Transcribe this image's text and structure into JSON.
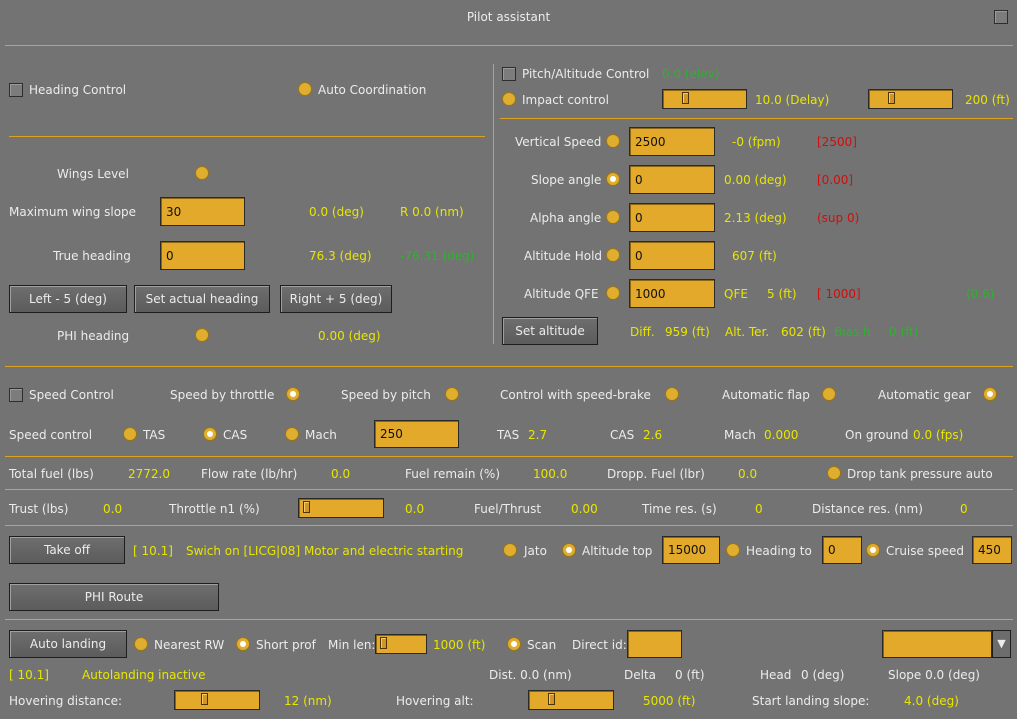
{
  "window": {
    "title": "Pilot assistant"
  },
  "heading": {
    "control_label": "Heading Control",
    "auto_coord_label": "Auto Coordination",
    "wings_level_label": "Wings Level",
    "max_wing_slope_label": "Maximum wing slope",
    "max_wing_slope_value": "30",
    "wing_slope_readout": "0.0 (deg)",
    "radius_readout": "R 0.0 (nm)",
    "true_heading_label": "True heading",
    "true_heading_value": "0",
    "true_heading_readout": "76.3 (deg)",
    "true_heading_delta": "-76.31 (deg)",
    "left_button": "Left - 5 (deg)",
    "set_actual_button": "Set actual heading",
    "right_button": "Right + 5 (deg)",
    "phi_heading_label": "PHI heading",
    "phi_heading_readout": "0.00 (deg)"
  },
  "pitch": {
    "control_label": "Pitch/Altitude Control",
    "elev_readout": "0.0 (elev)",
    "impact_label": "Impact control",
    "delay_readout": "10.0 (Delay)",
    "ft_readout": "200 (ft)",
    "delay_slider": 0.2,
    "ft_slider": 0.2,
    "rows": [
      {
        "label": "Vertical Speed",
        "value": "2500",
        "readout": "-0 (fpm)",
        "extra": "[2500]",
        "selected": false
      },
      {
        "label": "Slope angle",
        "value": "0",
        "readout": "0.00 (deg)",
        "extra": "[0.00]",
        "selected": true
      },
      {
        "label": "Alpha angle",
        "value": "0",
        "readout": "2.13 (deg)",
        "extra": "(sup 0)",
        "selected": false
      },
      {
        "label": "Altitude Hold",
        "value": "0",
        "readout": "607 (ft)",
        "extra": "",
        "selected": false
      },
      {
        "label": "Altitude QFE",
        "value": "1000",
        "readout": "QFE     5 (ft)",
        "extra": "[ 1000]",
        "selected": false
      }
    ],
    "qfe_green": "(0.6)",
    "set_altitude_button": "Set altitude",
    "diff_label": "Diff.",
    "diff_value": "959 (ft)",
    "alt_ter_label": "Alt. Ter.",
    "alt_ter_value": "602 (ft)",
    "bias_label": "Bias h",
    "bias_value": "0 (ft)"
  },
  "speed": {
    "control_label": "Speed Control",
    "by_throttle": "Speed by throttle",
    "by_pitch": "Speed by pitch",
    "speed_brake": "Control with speed-brake",
    "auto_flap": "Automatic flap",
    "auto_gear": "Automatic gear",
    "speed_control_label": "Speed control",
    "tas_label": "TAS",
    "cas_label": "CAS",
    "mach_label": "Mach",
    "speed_value": "250",
    "tas_readout_label": "TAS",
    "tas_readout": "2.7",
    "cas_readout_label": "CAS",
    "cas_readout": "2.6",
    "mach_readout_label": "Mach",
    "mach_readout": "0.000",
    "on_ground_label": "On ground",
    "on_ground_readout": "0.0 (fps)"
  },
  "fuel": {
    "total_label": "Total fuel (lbs)",
    "total_value": "2772.0",
    "flow_label": "Flow rate (lb/hr)",
    "flow_value": "0.0",
    "remain_label": "Fuel remain (%)",
    "remain_value": "100.0",
    "dropp_label": "Dropp. Fuel (lbr)",
    "dropp_value": "0.0",
    "drop_tank_label": "Drop tank pressure auto"
  },
  "thrust": {
    "trust_label": "Trust (lbs)",
    "trust_value": "0.0",
    "throttle_label": "Throttle n1 (%)",
    "throttle_value": "0.0",
    "throttle_slider": 0.0,
    "fuel_thrust_label": "Fuel/Thrust",
    "fuel_thrust_value": "0.00",
    "time_res_label": "Time res. (s)",
    "time_res_value": "0",
    "dist_res_label": "Distance res. (nm)",
    "dist_res_value": "0"
  },
  "takeoff": {
    "button": "Take off",
    "status_code": "[ 10.1]",
    "status_text": "Swich on [LICG|08] Motor and electric starting",
    "jato_label": "Jato",
    "alt_top_label": "Altitude top",
    "alt_top_value": "15000",
    "heading_to_label": "Heading to",
    "heading_to_value": "0",
    "cruise_label": "Cruise speed",
    "cruise_value": "450"
  },
  "route": {
    "button": "PHI Route"
  },
  "landing": {
    "button": "Auto landing",
    "nearest_label": "Nearest RW",
    "short_prof_label": "Short prof",
    "min_len_label": "Min len:",
    "min_len_readout": "1000 (ft)",
    "min_len_slider": 0.0,
    "scan_label": "Scan",
    "direct_id_label": "Direct id:",
    "direct_id_value": "",
    "status_code": "[ 10.1]",
    "status_text": "Autolanding inactive",
    "dist_label": "Dist. 0.0 (nm)",
    "delta_label": "Delta",
    "delta_value": "0 (ft)",
    "head_label": "Head",
    "head_value": "0 (deg)",
    "slope_label": "Slope 0.0 (deg)",
    "hover_dist_label": "Hovering distance:",
    "hover_dist_readout": "12 (nm)",
    "hover_dist_slider": 0.3,
    "hover_alt_label": "Hovering alt:",
    "hover_alt_readout": "5000 (ft)",
    "hover_alt_slider": 0.2,
    "start_slope_label": "Start landing slope:",
    "start_slope_readout": "4.0 (deg)"
  }
}
